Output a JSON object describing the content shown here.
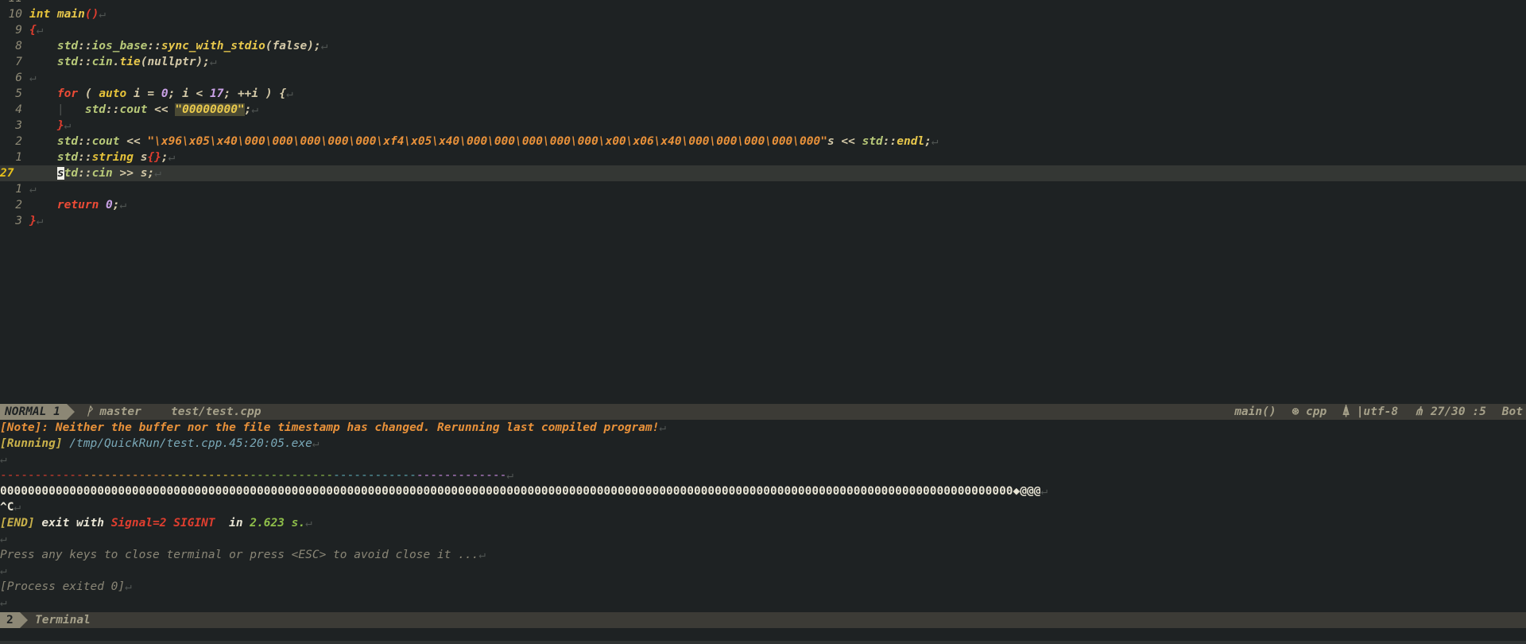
{
  "editor": {
    "partial_top_num": "11",
    "lines": [
      {
        "num": "10",
        "parts": [
          {
            "t": "int ",
            "c": "type"
          },
          {
            "t": "main",
            "c": "fn"
          },
          {
            "t": "()",
            "c": "br"
          }
        ]
      },
      {
        "num": "9",
        "parts": [
          {
            "t": "{",
            "c": "br"
          }
        ]
      },
      {
        "num": "8",
        "parts": [
          {
            "t": "    std",
            "c": "ns"
          },
          {
            "t": "::",
            "c": "op"
          },
          {
            "t": "ios_base",
            "c": "ns"
          },
          {
            "t": "::",
            "c": "op"
          },
          {
            "t": "sync_with_stdio",
            "c": "fn"
          },
          {
            "t": "(false);",
            "c": "op"
          }
        ]
      },
      {
        "num": "7",
        "parts": [
          {
            "t": "    std",
            "c": "ns"
          },
          {
            "t": "::",
            "c": "op"
          },
          {
            "t": "cin",
            "c": "ns"
          },
          {
            "t": ".",
            "c": "op"
          },
          {
            "t": "tie",
            "c": "fn"
          },
          {
            "t": "(nullptr);",
            "c": "op"
          }
        ]
      },
      {
        "num": "6",
        "parts": []
      },
      {
        "num": "5",
        "parts": [
          {
            "t": "    for",
            "c": "kw"
          },
          {
            "t": " ( ",
            "c": "op"
          },
          {
            "t": "auto",
            "c": "type"
          },
          {
            "t": " i = ",
            "c": "op"
          },
          {
            "t": "0",
            "c": "num"
          },
          {
            "t": "; i < ",
            "c": "op"
          },
          {
            "t": "17",
            "c": "num"
          },
          {
            "t": "; ++i ) {",
            "c": "op"
          }
        ]
      },
      {
        "num": "4",
        "parts": [
          {
            "t": "    ",
            "c": "op"
          },
          {
            "t": "|",
            "c": "guide"
          },
          {
            "t": "   std",
            "c": "ns"
          },
          {
            "t": "::",
            "c": "op"
          },
          {
            "t": "cout",
            "c": "ns"
          },
          {
            "t": " << ",
            "c": "op"
          },
          {
            "t": "\"00000000\"",
            "c": "hl"
          },
          {
            "t": ";",
            "c": "op"
          }
        ]
      },
      {
        "num": "3",
        "parts": [
          {
            "t": "    }",
            "c": "br"
          }
        ]
      },
      {
        "num": "2",
        "parts": [
          {
            "t": "    std",
            "c": "ns"
          },
          {
            "t": "::",
            "c": "op"
          },
          {
            "t": "cout",
            "c": "ns"
          },
          {
            "t": " << ",
            "c": "op"
          },
          {
            "t": "\"\\x96\\x05\\x40\\000\\000\\000\\000\\000\\xf4\\x05\\x40\\000\\000\\000\\000\\000\\x00\\x06\\x40\\000\\000\\000\\000\\000\"",
            "c": "str"
          },
          {
            "t": "s << ",
            "c": "op"
          },
          {
            "t": "std",
            "c": "ns"
          },
          {
            "t": "::",
            "c": "op"
          },
          {
            "t": "endl",
            "c": "fn"
          },
          {
            "t": ";",
            "c": "op"
          }
        ]
      },
      {
        "num": "1",
        "parts": [
          {
            "t": "    std",
            "c": "ns"
          },
          {
            "t": "::",
            "c": "op"
          },
          {
            "t": "string",
            "c": "type"
          },
          {
            "t": " s",
            "c": "op"
          },
          {
            "t": "{}",
            "c": "br"
          },
          {
            "t": ";",
            "c": "op"
          }
        ]
      },
      {
        "num": "27",
        "current": true,
        "parts": [
          {
            "t": "    ",
            "c": "op"
          },
          {
            "t": "s",
            "c": "cursor"
          },
          {
            "t": "td",
            "c": "ns"
          },
          {
            "t": "::",
            "c": "op"
          },
          {
            "t": "cin",
            "c": "ns"
          },
          {
            "t": " >> s;",
            "c": "op"
          }
        ]
      },
      {
        "num": "1",
        "parts": []
      },
      {
        "num": "2",
        "parts": [
          {
            "t": "    return ",
            "c": "kw"
          },
          {
            "t": "0",
            "c": "num"
          },
          {
            "t": ";",
            "c": "op"
          }
        ]
      },
      {
        "num": "3",
        "parts": [
          {
            "t": "}",
            "c": "br"
          }
        ]
      }
    ],
    "eol_mark": "↵"
  },
  "statusline": {
    "mode": "NORMAL 1",
    "branch": "ᚹ master",
    "file": "test/test.cpp",
    "function": "main()",
    "filetype": "⊛ cpp",
    "encoding": "⍋ |utf-8",
    "position": "⋔ 27/30 :5",
    "scroll": "Bot"
  },
  "terminal": {
    "note_tag": "[Note]",
    "note_text": ": Neither the buffer nor the file timestamp has changed. Rerunning last compiled program!",
    "running_tag": "[Running]",
    "running_path": " /tmp/QuickRun/test.cpp.45:20:05.exe",
    "output": "00000000000000000000000000000000000000000000000000000000000000000000000000000000000000000000000000000000000000000000000000000000000000000000000000◆@@@",
    "ctrl_c": "^C",
    "end_tag": "[END]",
    "end_exit": " exit with ",
    "end_signal": "Signal=2 SIGINT",
    "end_in": "  in ",
    "end_time": "2.623 s.",
    "press_msg": "Press any keys to close terminal or press <ESC> to avoid close it ...",
    "process_exited": "[Process exited 0]"
  },
  "termbar": {
    "number": "2",
    "name": "Terminal"
  },
  "colors": {
    "background": "#1e2223",
    "statusline": "#3c3b36",
    "keyword": "#ec4b36",
    "string": "#e8913a",
    "current_line_number": "#e8c21a"
  }
}
